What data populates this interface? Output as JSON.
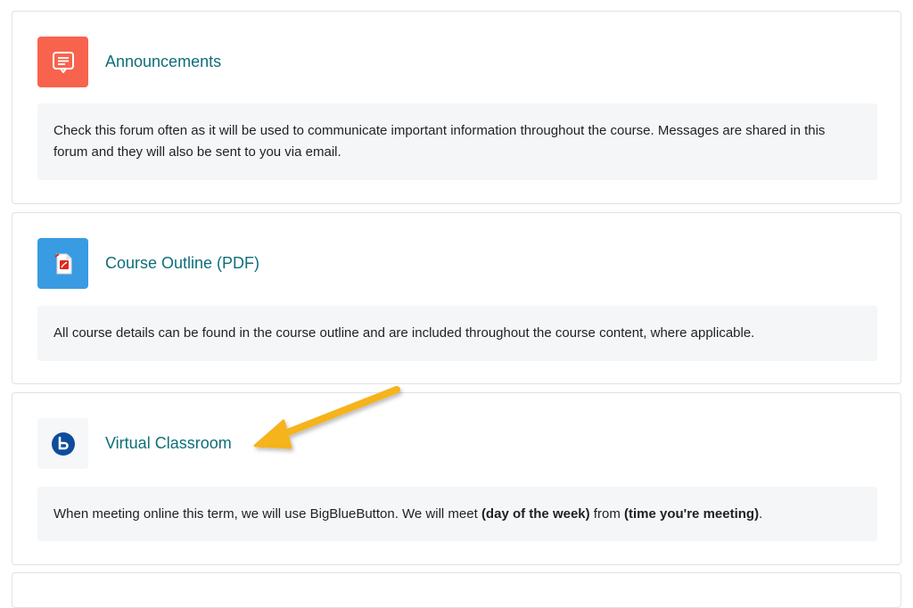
{
  "activities": [
    {
      "title": "Announcements",
      "icon": "forum-icon",
      "icon_color": "#f7634d",
      "description": "Check this forum often as it will be used to communicate important information throughout the course. Messages are shared in this forum and they will also be sent to you via email."
    },
    {
      "title": "Course Outline (PDF)",
      "icon": "pdf-file-icon",
      "icon_color": "#399be2",
      "description": "All course details can be found in the course outline and are included throughout the course content, where applicable."
    },
    {
      "title": "Virtual Classroom",
      "icon": "bigbluebutton-icon",
      "icon_color": "#0f4c9b",
      "description_parts": {
        "p1": "When meeting online this term, we will use BigBlueButton. We will meet ",
        "b1": "(day of the week)",
        "p2": " from ",
        "b2": "(time you're meeting)",
        "p3": "."
      }
    }
  ],
  "colors": {
    "link": "#0f6e79",
    "arrow": "#f5b31a",
    "card_border": "#dee2e6",
    "description_bg": "#f5f6f8"
  }
}
